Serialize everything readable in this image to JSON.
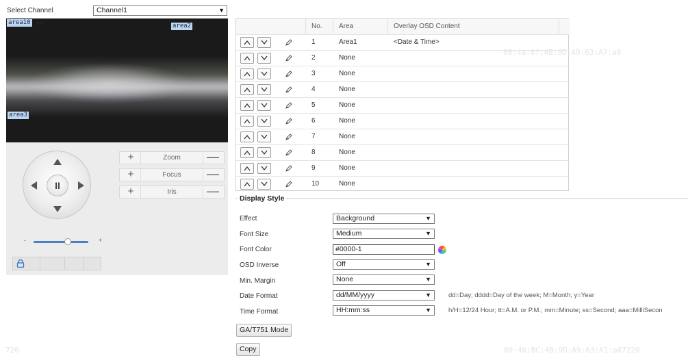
{
  "channel": {
    "label": "Select Channel",
    "value": "Channel1"
  },
  "video": {
    "areas": [
      {
        "label": "area10",
        "pos": "tl"
      },
      {
        "label": "area2",
        "pos": "tr"
      },
      {
        "label": "area3",
        "pos": "bl"
      }
    ]
  },
  "ptz": {
    "zoom": {
      "plus": "+",
      "label": "Zoom",
      "minus": "—"
    },
    "focus": {
      "plus": "+",
      "label": "Focus",
      "minus": "—"
    },
    "iris": {
      "plus": "+",
      "label": "Iris",
      "minus": "—"
    },
    "pause": "II",
    "slider": {
      "minus": "-",
      "plus": "+",
      "level_percent": 63
    }
  },
  "table": {
    "headers": {
      "no": "No.",
      "area": "Area",
      "content": "Overlay OSD Content"
    },
    "rows": [
      {
        "no": "1",
        "area": "Area1",
        "content": "<Date & Time>"
      },
      {
        "no": "2",
        "area": "None",
        "content": ""
      },
      {
        "no": "3",
        "area": "None",
        "content": ""
      },
      {
        "no": "4",
        "area": "None",
        "content": ""
      },
      {
        "no": "5",
        "area": "None",
        "content": ""
      },
      {
        "no": "6",
        "area": "None",
        "content": ""
      },
      {
        "no": "7",
        "area": "None",
        "content": ""
      },
      {
        "no": "8",
        "area": "None",
        "content": ""
      },
      {
        "no": "9",
        "area": "None",
        "content": ""
      },
      {
        "no": "10",
        "area": "None",
        "content": ""
      }
    ]
  },
  "watermarks": {
    "top_right": "00:4a:0f:4B:9D:A9:63:A7:a0",
    "bottom_left": "720",
    "bottom_right": "00:4b:BC:4B:9D:A9:63:A1:a07220"
  },
  "display_style": {
    "legend": "Display Style",
    "effect": {
      "label": "Effect",
      "value": "Background"
    },
    "font_size": {
      "label": "Font Size",
      "value": "Medium"
    },
    "font_color": {
      "label": "Font Color",
      "value": "#0000-1"
    },
    "osd_inverse": {
      "label": "OSD Inverse",
      "value": "Off"
    },
    "min_margin": {
      "label": "Min. Margin",
      "value": "None"
    },
    "date_format": {
      "label": "Date Format",
      "value": "dd/MM/yyyy",
      "hint": "dd=Day; dddd=Day of the week; M=Month; y=Year"
    },
    "time_format": {
      "label": "Time Format",
      "value": "HH:mm:ss",
      "hint": "h/H=12/24 Hour; tt=A.M. or P.M.; mm=Minute; ss=Second; aaa=MilliSecon"
    }
  },
  "buttons": {
    "gat_mode": "GA/T751 Mode",
    "copy": "Copy"
  },
  "colors": {
    "area_tag_bg": "#bcd6f2",
    "slider_track": "#4a7fc1",
    "panel_bg": "#ececec"
  }
}
